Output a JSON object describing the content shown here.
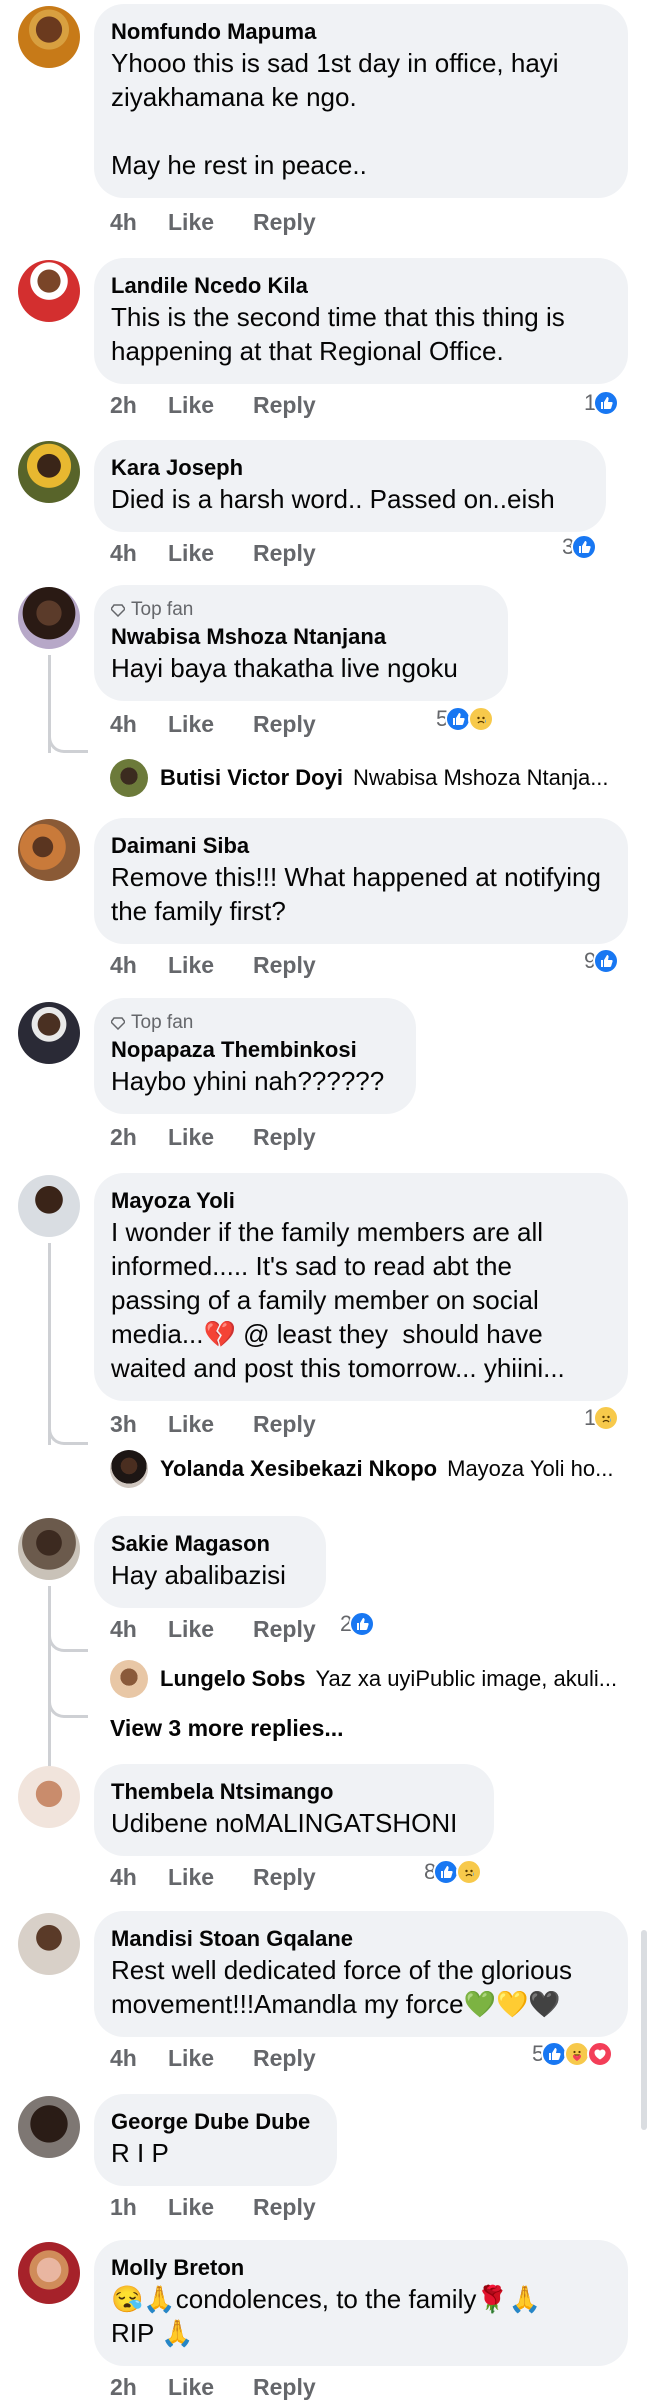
{
  "comments": [
    {
      "author": "Nomfundo Mapuma",
      "text": "Yhooo this is sad 1st day in office, hayi ziyakhamana ke ngo.\n\nMay he rest in peace..",
      "time": "4h",
      "like": "Like",
      "reply": "Reply"
    },
    {
      "author": "Landile Ncedo Kila",
      "text": "This is the second time that this thing is happening at that Regional Office.",
      "time": "2h",
      "like": "Like",
      "reply": "Reply",
      "reaction_count": "1"
    },
    {
      "author": "Kara Joseph",
      "text": "Died is a harsh word.. Passed on..eish",
      "time": "4h",
      "like": "Like",
      "reply": "Reply",
      "reaction_count": "3"
    },
    {
      "badge": "Top fan",
      "author": "Nwabisa Mshoza Ntanjana",
      "text": "Hayi baya thakatha live ngoku",
      "time": "4h",
      "like": "Like",
      "reply": "Reply",
      "reaction_count": "5",
      "reply_author": "Butisi Victor Doyi",
      "reply_text": "Nwabisa Mshoza Ntanja..."
    },
    {
      "author": "Daimani Siba",
      "text": "Remove this!!! What happened at notifying the family first?",
      "time": "4h",
      "like": "Like",
      "reply": "Reply",
      "reaction_count": "9"
    },
    {
      "badge": "Top fan",
      "author": "Nopapaza Thembinkosi",
      "text": "Haybo yhini nah??????",
      "time": "2h",
      "like": "Like",
      "reply": "Reply"
    },
    {
      "author": "Mayoza Yoli",
      "text": "I wonder if the family members are all informed..... It's sad to read abt the passing of a family member on social media...💔 @ least they  should have waited and post this tomorrow... yhiini...",
      "time": "3h",
      "like": "Like",
      "reply": "Reply",
      "reaction_count": "1",
      "reply_author": "Yolanda Xesibekazi Nkopo",
      "reply_text": "Mayoza Yoli ho..."
    },
    {
      "author": "Sakie Magason",
      "text": "Hay abalibazisi",
      "time": "4h",
      "like": "Like",
      "reply": "Reply",
      "reaction_count": "2",
      "reply_author": "Lungelo Sobs",
      "reply_text": "Yaz xa uyiPublic image, akuli...",
      "view_more": "View 3 more replies..."
    },
    {
      "author": "Thembela Ntsimango",
      "text": "Udibene noMALINGATSHONI",
      "time": "4h",
      "like": "Like",
      "reply": "Reply",
      "reaction_count": "8"
    },
    {
      "author": "Mandisi Stoan Gqalane",
      "text": "Rest well dedicated force of the glorious movement!!!Amandla my force💚💛🖤",
      "time": "4h",
      "like": "Like",
      "reply": "Reply",
      "reaction_count": "5"
    },
    {
      "author": "George Dube Dube",
      "text": "R I P",
      "time": "1h",
      "like": "Like",
      "reply": "Reply"
    },
    {
      "author": "Molly Breton",
      "text": "😪🙏condolences, to the family🌹🙏\nRIP 🙏",
      "time": "2h",
      "like": "Like",
      "reply": "Reply"
    }
  ],
  "icons": {
    "like": "like-reaction-icon",
    "sad": "sad-reaction-icon",
    "care": "care-reaction-icon",
    "love": "love-reaction-icon",
    "topfan": "diamond-badge-icon"
  },
  "colors": {
    "bubble": "#f0f2f5",
    "like_blue": "#1877f2",
    "meta_gray": "#65676b"
  }
}
